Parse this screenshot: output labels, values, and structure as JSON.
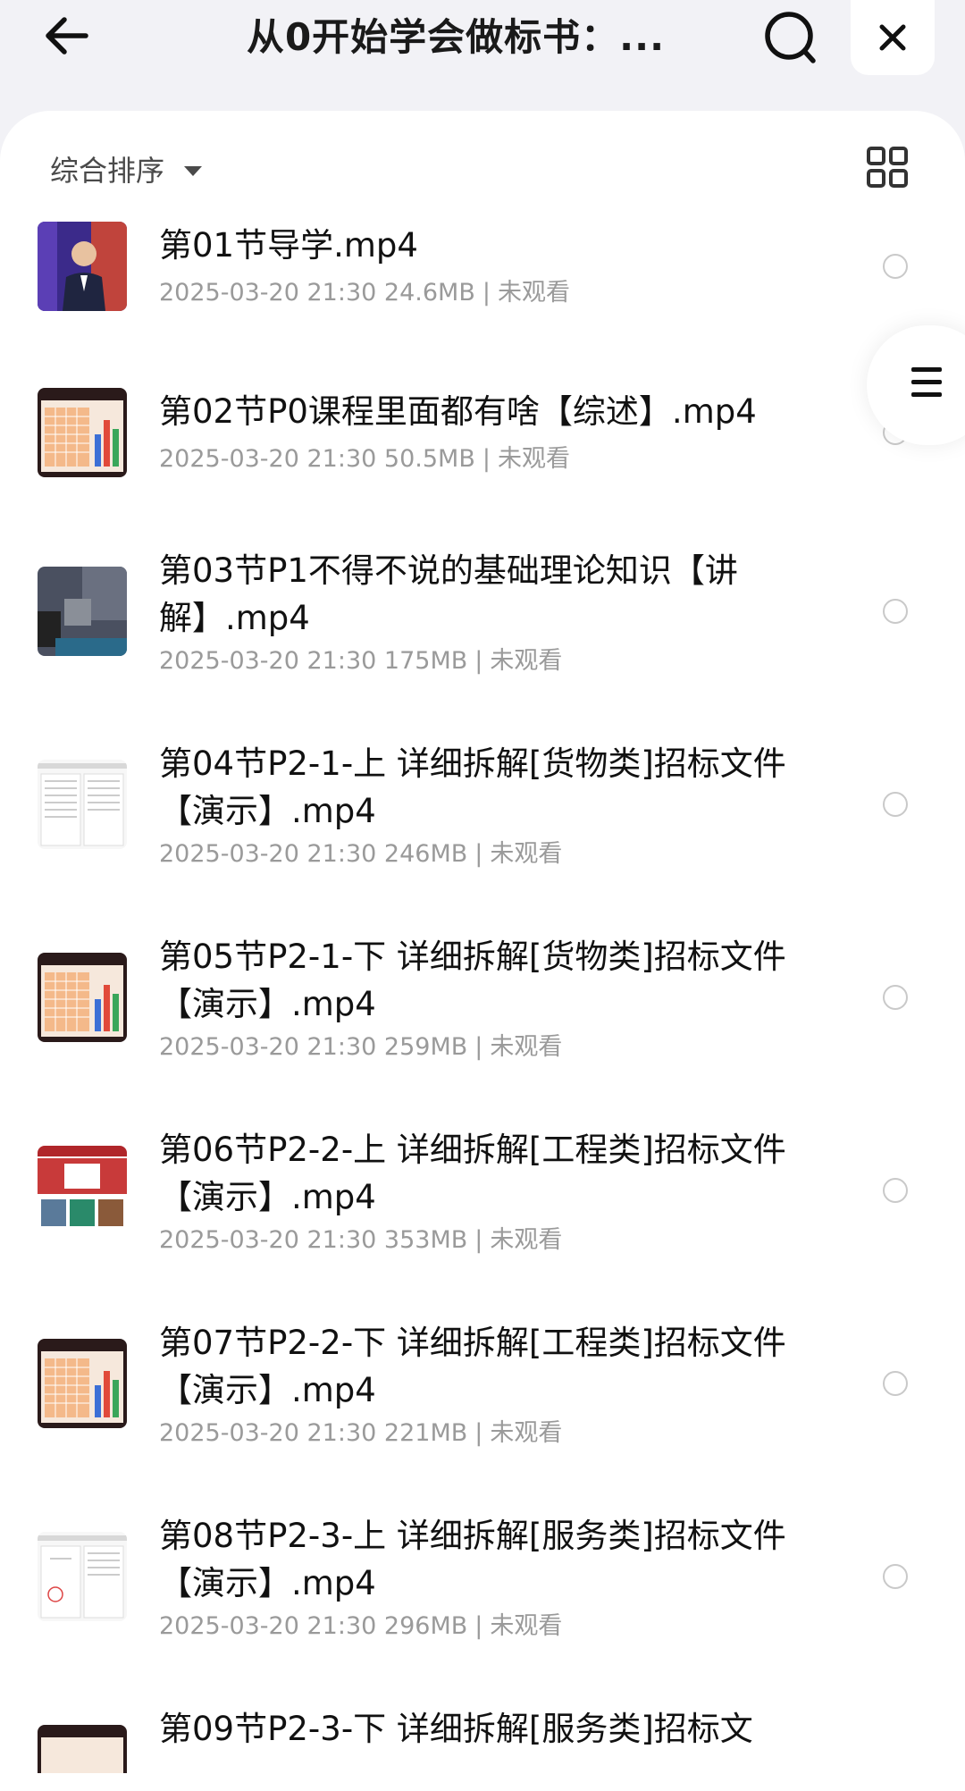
{
  "header": {
    "title": "从0开始学会做标书：...",
    "back_icon": "arrow-left-icon",
    "search_icon": "search-icon",
    "close_icon": "close-icon"
  },
  "toolbar": {
    "sort_label": "综合排序",
    "sort_icon": "caret-down-icon",
    "view_icon": "grid-view-icon"
  },
  "float_menu": {
    "icon": "menu-icon"
  },
  "files": [
    {
      "name": "第01节导学.mp4",
      "date": "2025-03-20 21:30",
      "size": "24.6MB",
      "status": "未观看",
      "thumb": "photo-speaker"
    },
    {
      "name": "第02节P0课程里面都有啥【综述】.mp4",
      "date": "2025-03-20 21:30",
      "size": "50.5MB",
      "status": "未观看",
      "thumb": "spreadsheet-chart"
    },
    {
      "name": "第03节P1不得不说的基础理论知识【讲解】.mp4",
      "date": "2025-03-20 21:30",
      "size": "175MB",
      "status": "未观看",
      "thumb": "dark-slide"
    },
    {
      "name": "第04节P2-1-上 详细拆解[货物类]招标文件【演示】.mp4",
      "date": "2025-03-20 21:30",
      "size": "246MB",
      "status": "未观看",
      "thumb": "document"
    },
    {
      "name": "第05节P2-1-下 详细拆解[货物类]招标文件【演示】.mp4",
      "date": "2025-03-20 21:30",
      "size": "259MB",
      "status": "未观看",
      "thumb": "spreadsheet-chart"
    },
    {
      "name": "第06节P2-2-上 详细拆解[工程类]招标文件【演示】.mp4",
      "date": "2025-03-20 21:30",
      "size": "353MB",
      "status": "未观看",
      "thumb": "website"
    },
    {
      "name": "第07节P2-2-下 详细拆解[工程类]招标文件【演示】.mp4",
      "date": "2025-03-20 21:30",
      "size": "221MB",
      "status": "未观看",
      "thumb": "spreadsheet-chart"
    },
    {
      "name": "第08节P2-3-上 详细拆解[服务类]招标文件【演示】.mp4",
      "date": "2025-03-20 21:30",
      "size": "296MB",
      "status": "未观看",
      "thumb": "document"
    },
    {
      "name": "第09节P2-3-下 详细拆解[服务类]招标文",
      "date": "",
      "size": "",
      "status": "",
      "thumb": "spreadsheet-chart"
    }
  ]
}
